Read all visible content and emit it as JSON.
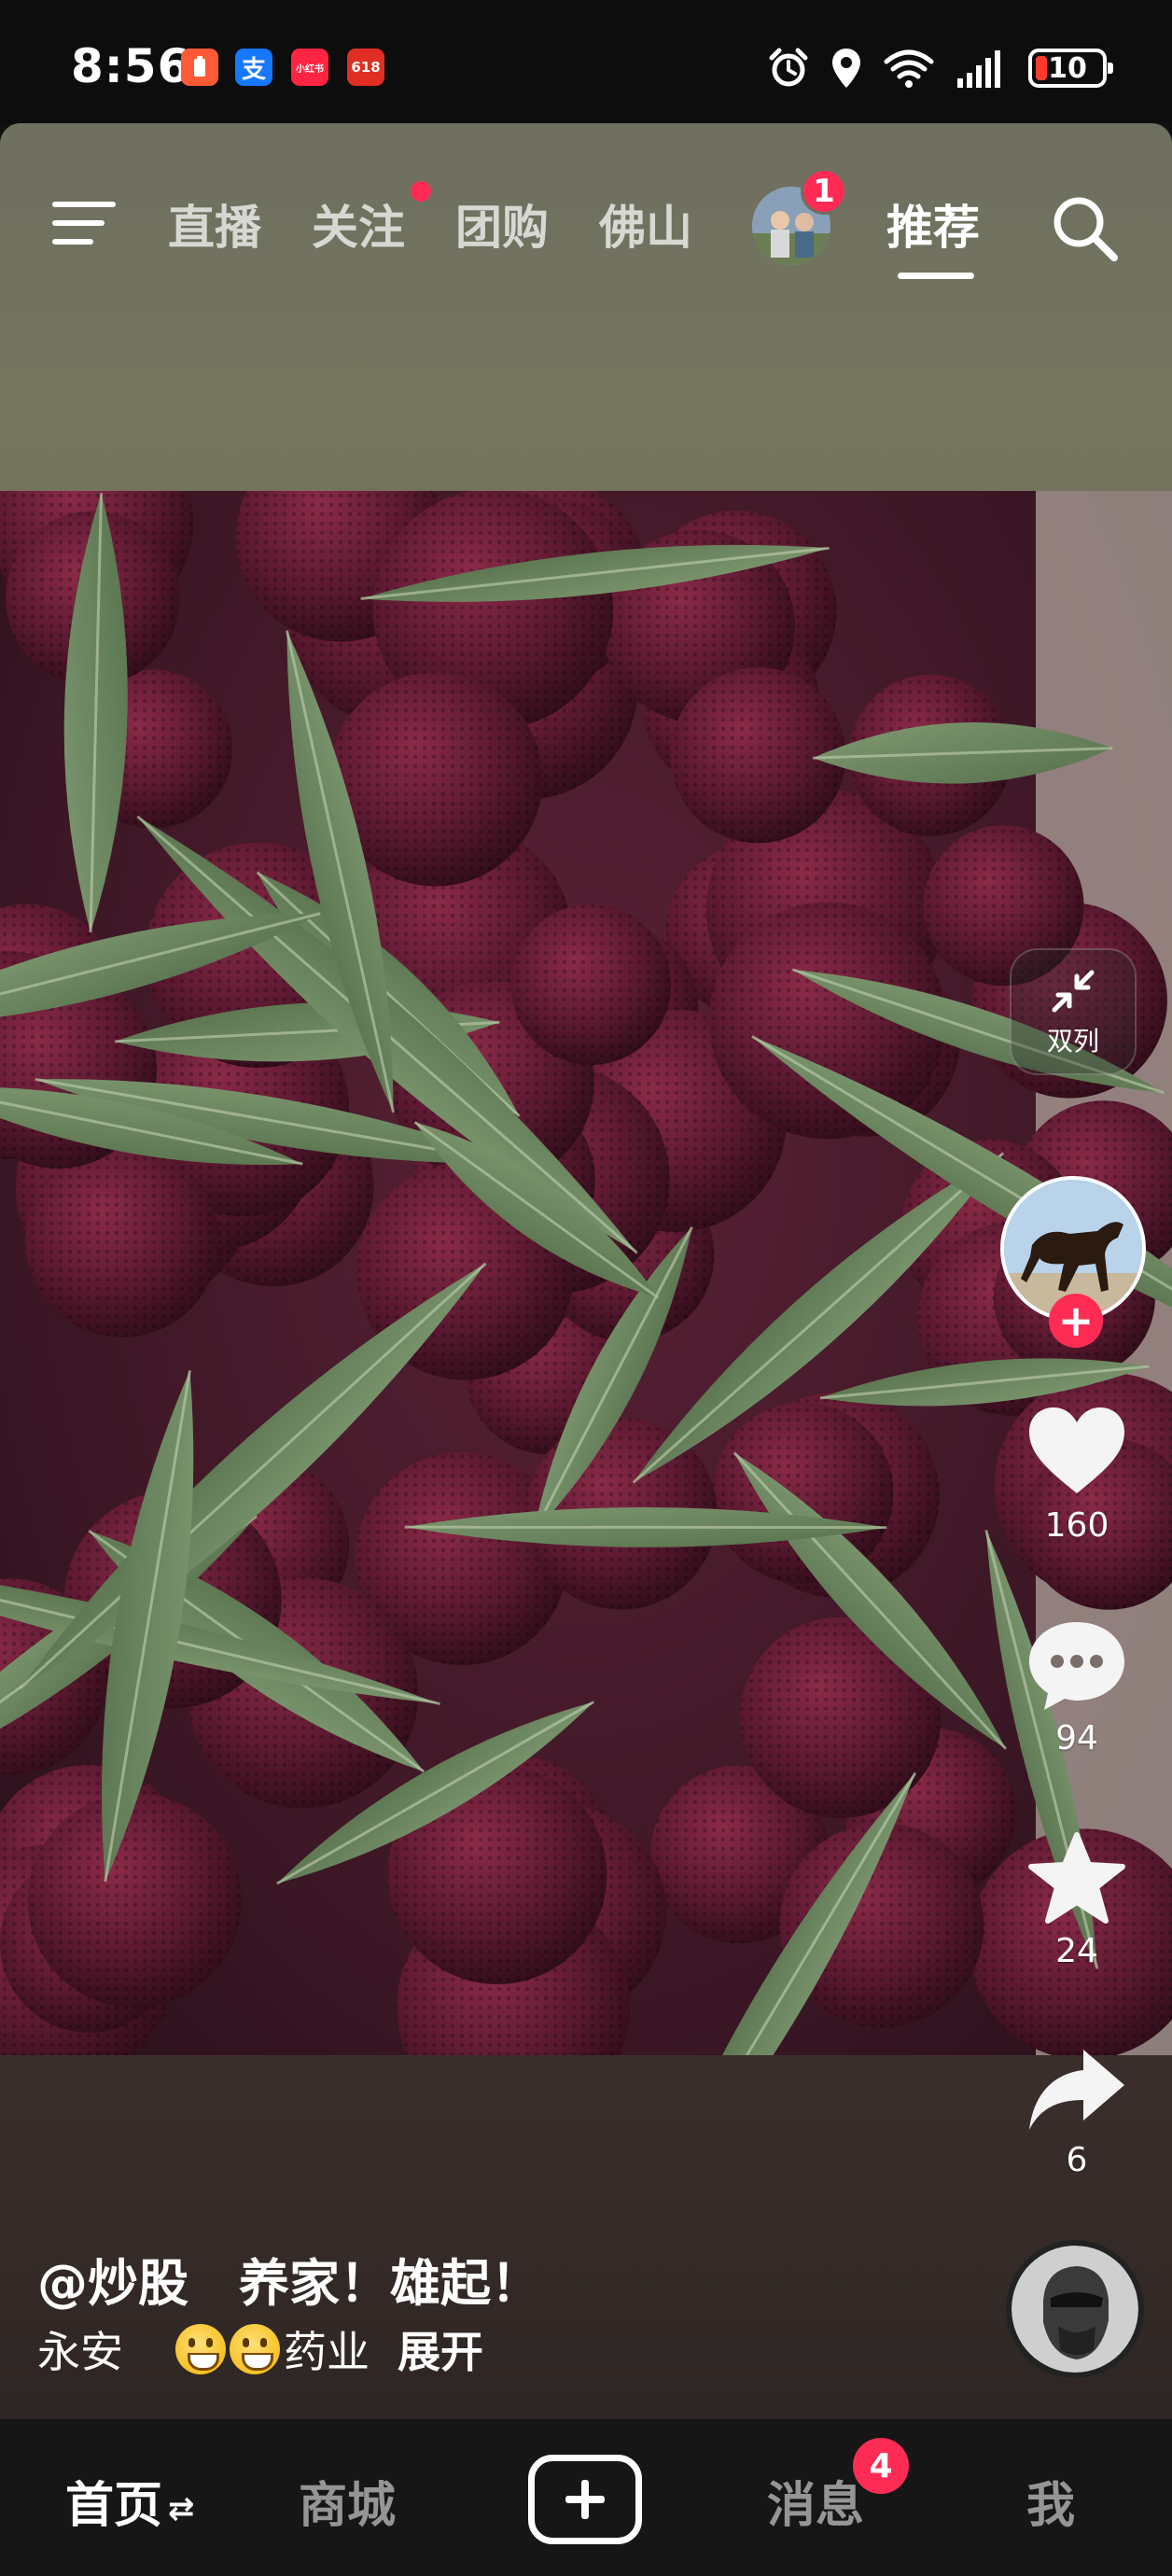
{
  "status_bar": {
    "time": "8:56",
    "apps": [
      {
        "name": "battery-saver-app-icon",
        "label": "",
        "color": "#ff5a36"
      },
      {
        "name": "alipay-app-icon",
        "label": "支",
        "color": "#1677ff"
      },
      {
        "name": "xiaohongshu-app-icon",
        "label": "小红书",
        "color": "#ff2442"
      },
      {
        "name": "pinduoduo-app-icon",
        "label": "618",
        "color": "#e02e24"
      }
    ],
    "battery": "10"
  },
  "top_nav": {
    "tabs": [
      "直播",
      "关注",
      "团购",
      "佛山",
      "推荐"
    ],
    "avatar_badge": "1",
    "active_tab": "推荐"
  },
  "right_rail": {
    "dual_column_label": "双列",
    "likes": "160",
    "comments": "94",
    "favorites": "24",
    "shares": "6"
  },
  "caption": {
    "author": "@炒股　养家！雄起！",
    "text_before": "永安",
    "text_after": "药业",
    "expand": "展开"
  },
  "bottom_nav": {
    "home": "首页",
    "mall": "商城",
    "messages": "消息",
    "messages_badge": "4",
    "me": "我"
  },
  "colors": {
    "accent": "#fe2c55",
    "background": "#111111"
  }
}
